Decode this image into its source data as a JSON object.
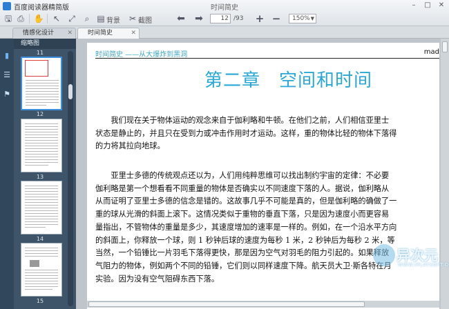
{
  "app": {
    "title": "百度阅读器精简版",
    "document_title": "时间简史"
  },
  "toolbar": {
    "background_label": "背景",
    "screenshot_label": "截图",
    "page_current": "12",
    "page_total": "/93",
    "zoom": "150%"
  },
  "tabs": [
    {
      "label": "情感化设计"
    },
    {
      "label": "时间简史"
    }
  ],
  "thumbnails": {
    "header": "缩略图",
    "pages": [
      "11",
      "12",
      "13",
      "14",
      "15"
    ]
  },
  "document": {
    "running_head": "时间简史 ——从大爆炸到黑洞",
    "running_head_right": "mad",
    "chapter_title": "第二章　空间和时间",
    "paragraph1": [
      "　　我们现在关于物体运动的观念来自于伽利略和牛顿。在他们之前，人们相信亚里士",
      "状态是静止的，并且只在受到力或冲击作用时才运动。这样，重的物体比轻的物体下落得",
      "的力将其拉向地球。"
    ],
    "paragraph2": [
      "　　亚里士多德的传统观点还以为，人们用纯粹思维可以找出制约宇宙的定律：不必要",
      "伽利略是第一个想看看不同重量的物体是否确实以不同速度下落的人。据说，伽利略从",
      "从而证明了亚里士多德的信念是错的。这故事几乎不可能是真的，但是伽利略的确做了一",
      "重的球从光滑的斜面上滚下。这情况类似于重物的垂直下落，只是因为速度小而更容易",
      "量指出，不管物体的重量是多少，其速度增加的速率是一样的。例如，在一个沿水平方向",
      "的斜面上，你释放一个球，则 1 秒钟后球的速度为每秒 1 米，2 秒钟后为每秒 2 米，等",
      "当然，一个铅锤比一片羽毛下落得更快，那是因为空气对羽毛的阻力引起的。如果释放",
      "气阻力的物体，例如两个不同的铅锤，它们则以同样速度下降。航天员大卫·斯各特在月",
      "实验。因为没有空气阻碍东西下落。"
    ]
  },
  "watermark": {
    "text": "异次元",
    "sub": "WWW.IPLAYSOFT.COM"
  },
  "colors": {
    "accent": "#29a8d6",
    "sidebar": "#31475b",
    "selected": "#3d8fe0"
  }
}
